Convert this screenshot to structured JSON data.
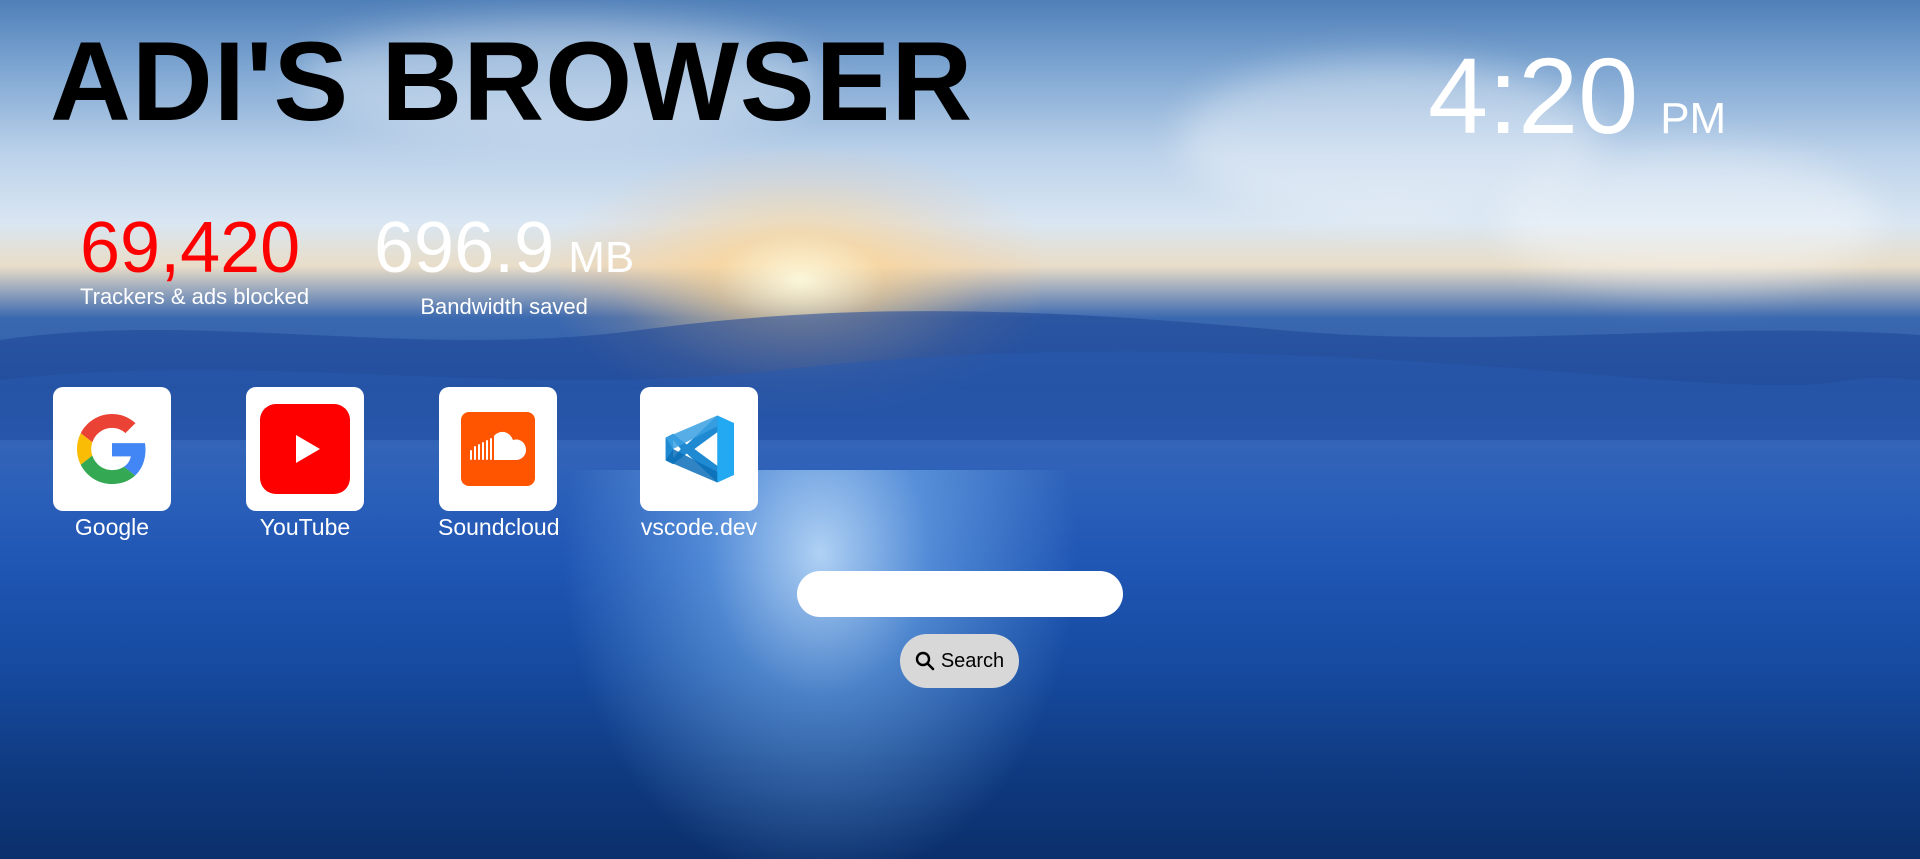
{
  "header": {
    "title": "ADI'S BROWSER"
  },
  "clock": {
    "time": "4:20",
    "period": "PM"
  },
  "stats": {
    "trackers": {
      "value": "69,420",
      "label": "Trackers & ads blocked",
      "color": "#ff0000"
    },
    "bandwidth": {
      "value": "696.9",
      "unit": "MB",
      "label": "Bandwidth saved"
    }
  },
  "shortcuts": [
    {
      "label": "Google",
      "icon": "google-icon"
    },
    {
      "label": "YouTube",
      "icon": "youtube-icon"
    },
    {
      "label": "Soundcloud",
      "icon": "soundcloud-icon"
    },
    {
      "label": "vscode.dev",
      "icon": "vscode-icon"
    }
  ],
  "search": {
    "input_value": "",
    "button_label": "Search",
    "icon": "search-icon"
  },
  "colors": {
    "youtube": "#ff0000",
    "soundcloud": "#ff5500",
    "vscode": "#23a9f2"
  }
}
